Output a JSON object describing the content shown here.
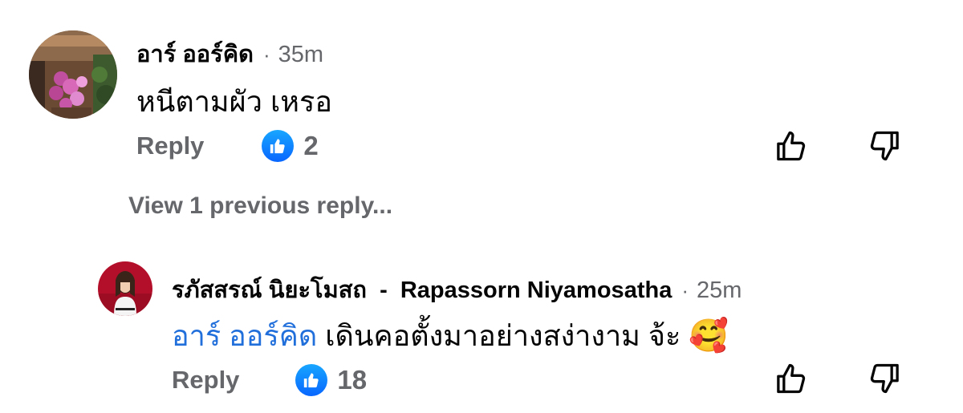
{
  "comment": {
    "author": "อาร์ ออร์คิด",
    "separator": "·",
    "time": "35m",
    "text": "หนีตามผัว เหรอ",
    "reply_label": "Reply",
    "like_count": "2"
  },
  "view_previous": {
    "label": "View 1 previous reply..."
  },
  "reply": {
    "author": "รภัสสรณ์ นิยะโมสถ  -  Rapassorn Niyamosatha",
    "separator": "·",
    "time": "25m",
    "mention": "อาร์ ออร์คิด",
    "text": " เดินคอตั้งมาอย่างสง่างาม จ้ะ ",
    "emoji": "🥰",
    "reply_label": "Reply",
    "like_count": "18"
  },
  "colors": {
    "like_blue": "#0866ff",
    "mention_blue": "#216fdb",
    "secondary_text": "#65676b"
  },
  "icons": {
    "like_reaction": "thumbs-up-icon",
    "upvote": "thumbs-up-outline-icon",
    "downvote": "thumbs-down-outline-icon"
  }
}
